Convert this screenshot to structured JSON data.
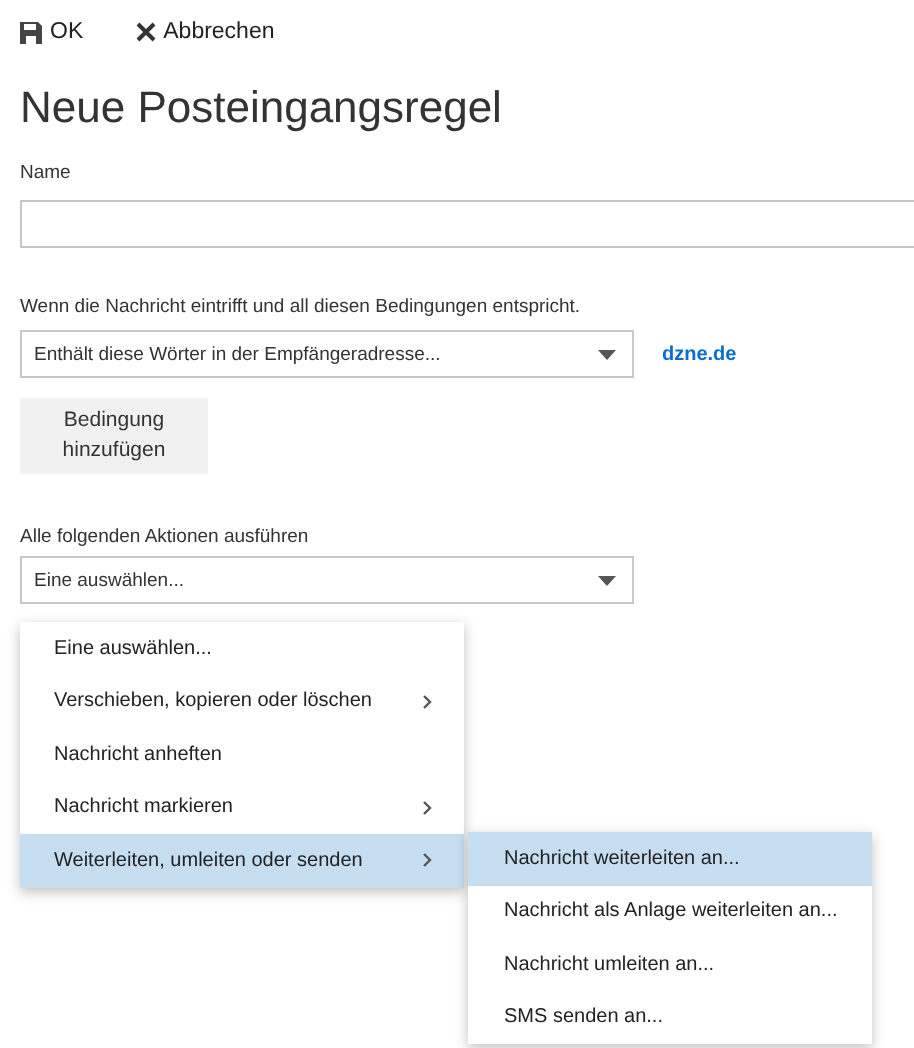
{
  "toolbar": [
    {
      "kind": "save",
      "label": "OK"
    },
    {
      "kind": "cancel",
      "label": "Abbrechen"
    }
  ],
  "title": "Neue Posteingangsregel",
  "name_field": {
    "label": "Name"
  },
  "conditions": {
    "label": "Wenn die Nachricht eintrifft und all diesen Bedingungen entspricht.",
    "select": "Enthält diese Wörter in der Empfängeradresse...",
    "link": "dzne.de",
    "add_button": "Bedingung hinzufügen"
  },
  "actions": {
    "label": "Alle folgenden Aktionen ausführen",
    "select": "Eine auswählen..."
  },
  "menu": [
    {
      "label": "Eine auswählen...",
      "submenu": false,
      "selected": false
    },
    {
      "label": "Verschieben, kopieren oder löschen",
      "submenu": true,
      "selected": false
    },
    {
      "label": "Nachricht anheften",
      "submenu": false,
      "selected": false
    },
    {
      "label": "Nachricht markieren",
      "submenu": true,
      "selected": false
    },
    {
      "label": "Weiterleiten, umleiten oder senden",
      "submenu": true,
      "selected": true
    }
  ],
  "submenu": [
    {
      "label": "Nachricht weiterleiten an...",
      "selected": true
    },
    {
      "label": "Nachricht als Anlage weiterleiten an...",
      "selected": false
    },
    {
      "label": "Nachricht umleiten an...",
      "selected": false
    },
    {
      "label": "SMS senden an...",
      "selected": false
    }
  ]
}
